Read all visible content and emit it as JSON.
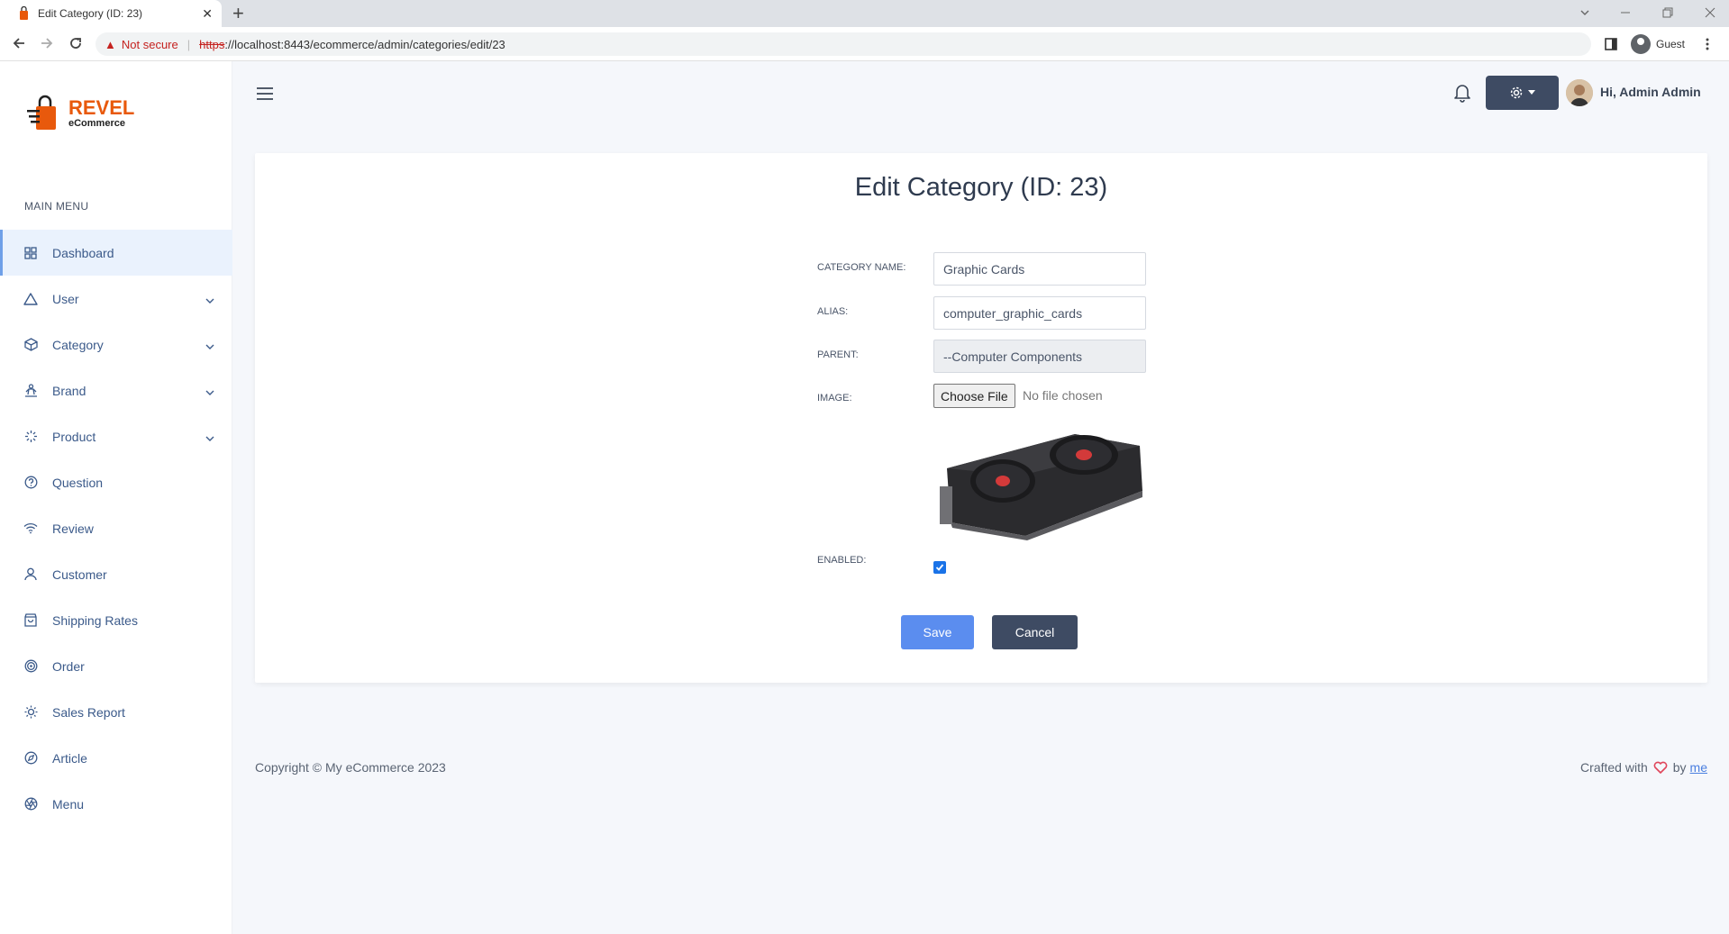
{
  "browser": {
    "tab_title": "Edit Category (ID: 23)",
    "tab_close": "✕",
    "new_tab": "+",
    "security_label": "Not secure",
    "url_scheme": "https",
    "url_rest": "://localhost:8443/ecommerce/admin/categories/edit/23",
    "profile_label": "Guest"
  },
  "sidebar": {
    "logo_main": "REVEL",
    "logo_sub": "eCommerce",
    "menu_title": "MAIN MENU",
    "items": [
      {
        "label": "Dashboard",
        "icon": "grid-icon",
        "active": true,
        "expandable": false
      },
      {
        "label": "User",
        "icon": "triangle-icon",
        "active": false,
        "expandable": true
      },
      {
        "label": "Category",
        "icon": "cube-icon",
        "active": false,
        "expandable": true
      },
      {
        "label": "Brand",
        "icon": "person-activity-icon",
        "active": false,
        "expandable": true
      },
      {
        "label": "Product",
        "icon": "loader-icon",
        "active": false,
        "expandable": true
      },
      {
        "label": "Question",
        "icon": "help-circle-icon",
        "active": false,
        "expandable": false
      },
      {
        "label": "Review",
        "icon": "wifi-icon",
        "active": false,
        "expandable": false
      },
      {
        "label": "Customer",
        "icon": "user-icon",
        "active": false,
        "expandable": false
      },
      {
        "label": "Shipping Rates",
        "icon": "shopping-bag-icon",
        "active": false,
        "expandable": false
      },
      {
        "label": "Order",
        "icon": "target-icon",
        "active": false,
        "expandable": false
      },
      {
        "label": "Sales Report",
        "icon": "sun-icon",
        "active": false,
        "expandable": false
      },
      {
        "label": "Article",
        "icon": "compass-icon",
        "active": false,
        "expandable": false
      },
      {
        "label": "Menu",
        "icon": "aperture-icon",
        "active": false,
        "expandable": false
      }
    ]
  },
  "header": {
    "greeting": "Hi, Admin Admin"
  },
  "form": {
    "title": "Edit Category (ID: 23)",
    "name_label": "CATEGORY NAME:",
    "name_value": "Graphic Cards",
    "alias_label": "ALIAS:",
    "alias_value": "computer_graphic_cards",
    "parent_label": "PARENT:",
    "parent_value": "--Computer Components",
    "image_label": "IMAGE:",
    "choose_file_label": "Choose File",
    "no_file_text": "No file chosen",
    "enabled_label": "ENABLED:",
    "enabled": true,
    "save_label": "Save",
    "cancel_label": "Cancel"
  },
  "footer": {
    "copyright": "Copyright © My eCommerce 2023",
    "crafted_prefix": "Crafted with",
    "crafted_by": "by",
    "crafted_link": "me"
  },
  "colors": {
    "accent": "#5b8def",
    "dark_button": "#3e4b63",
    "brand": "#e8590c"
  }
}
